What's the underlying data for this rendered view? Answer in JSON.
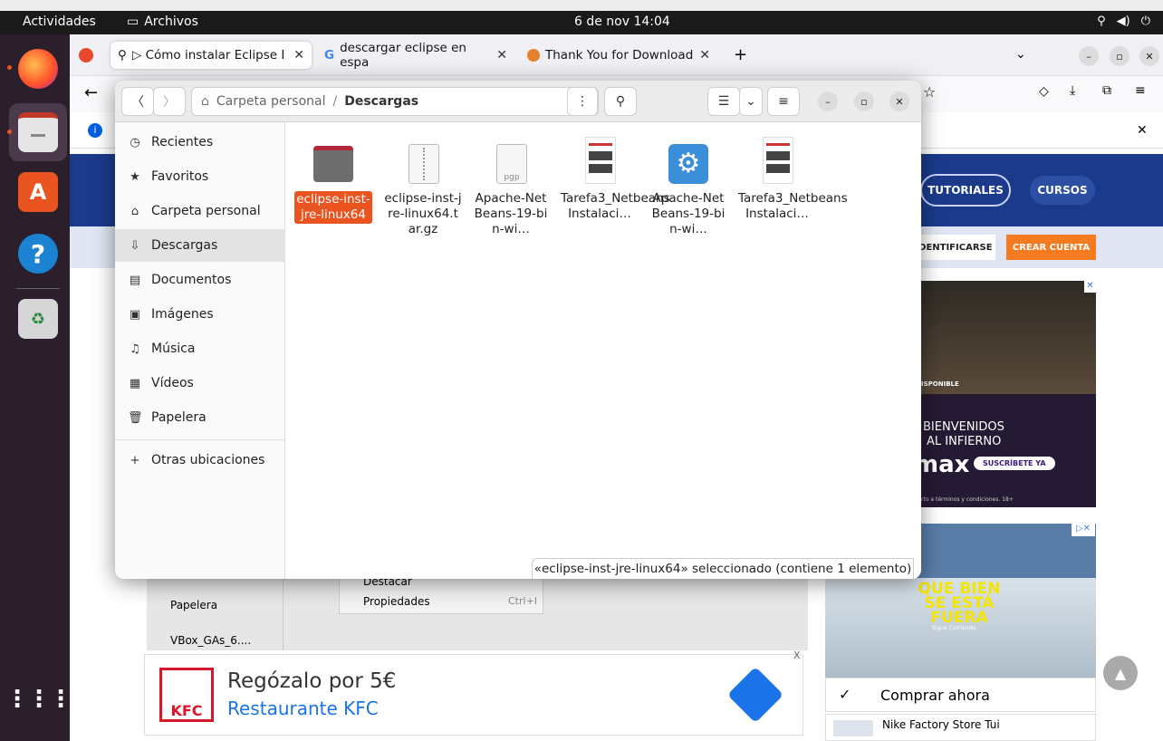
{
  "topbar": {
    "activities": "Actividades",
    "files": "Archivos",
    "clock": "6 de nov  14:04"
  },
  "browser": {
    "tabs": [
      {
        "label": "▷ Cómo instalar Eclipse I",
        "active": true
      },
      {
        "label": "descargar eclipse en espa",
        "active": false
      },
      {
        "label": "Thank You for Download",
        "active": false
      }
    ],
    "new_tab": "+",
    "site": {
      "nav": [
        "TUTORIALES",
        "CURSOS"
      ],
      "login": "IDENTIFICARSE",
      "register": "CREAR CUENTA"
    }
  },
  "ads": {
    "hbo": {
      "line1": "BIENVENIDOS",
      "line2": "AL INFIERNO",
      "brand": "max",
      "cta": "SUSCRÍBETE YA",
      "tag": "ISPONIBLE",
      "fine": "rto a términos y condiciones. 18+"
    },
    "nike": {
      "headline": "QUE BIEN SE ESTÁ FUERA",
      "sub": "Sigue Corriendo",
      "cta": "Comprar ahora",
      "store": "Nike Factory Store Tui"
    },
    "kfc": {
      "title": "Regózalo por 5€",
      "subtitle": "Restaurante KFC",
      "logo": "KFC"
    }
  },
  "bg_fm": {
    "trash": "Papelera",
    "vbox": "VBox_GAs_6....",
    "menu": [
      {
        "label": "Destacar",
        "shortcut": ""
      },
      {
        "label": "Propiedades",
        "shortcut": "Ctrl+I"
      }
    ]
  },
  "nautilus": {
    "path": [
      "Carpeta personal",
      "Descargas"
    ],
    "sidebar": [
      {
        "label": "Recientes",
        "icon": "clock-icon",
        "selected": false
      },
      {
        "label": "Favoritos",
        "icon": "star-icon",
        "selected": false
      },
      {
        "label": "Carpeta personal",
        "icon": "home-icon",
        "selected": false
      },
      {
        "label": "Descargas",
        "icon": "download-icon",
        "selected": true
      },
      {
        "label": "Documentos",
        "icon": "document-icon",
        "selected": false
      },
      {
        "label": "Imágenes",
        "icon": "image-icon",
        "selected": false
      },
      {
        "label": "Música",
        "icon": "music-icon",
        "selected": false
      },
      {
        "label": "Vídeos",
        "icon": "video-icon",
        "selected": false
      },
      {
        "label": "Papelera",
        "icon": "trash-icon",
        "selected": false
      }
    ],
    "other": "Otras ubicaciones",
    "files": [
      {
        "name": "eclipse-inst-jre-linux64",
        "type": "folder",
        "selected": true
      },
      {
        "name": "eclipse-inst-jre-linux64.tar.gz",
        "type": "archive"
      },
      {
        "name": "Apache-NetBeans-19-bin-wi…",
        "type": "pgp"
      },
      {
        "name": "Tarefa3_Netbeans Instalaci…",
        "type": "screenshot"
      },
      {
        "name": "Apache-NetBeans-19-bin-wi…",
        "type": "exe"
      },
      {
        "name": "Tarefa3_Netbeans Instalaci…",
        "type": "screenshot"
      }
    ],
    "status": "«eclipse-inst-jre-linux64» seleccionado  (contiene 1 elemento)"
  }
}
